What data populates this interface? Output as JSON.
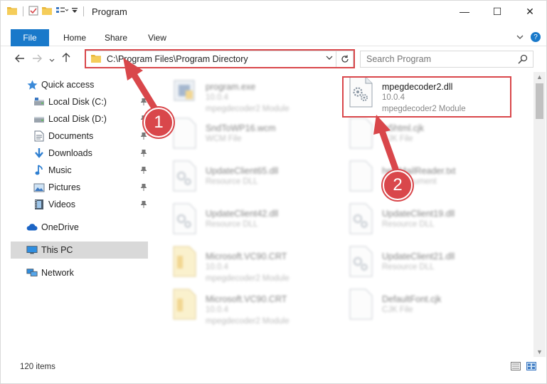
{
  "window": {
    "title": "Program",
    "controls": [
      "—",
      "☐",
      "✕"
    ]
  },
  "ribbon": {
    "tabs": [
      "File",
      "Home",
      "Share",
      "View"
    ],
    "help": "?"
  },
  "address": {
    "path": "C:\\Program Files\\Program Directory"
  },
  "search": {
    "placeholder": "Search Program"
  },
  "navpane": {
    "items": [
      {
        "label": "Quick access",
        "icon": "star-icon",
        "pinned": false
      },
      {
        "label": "Local Disk (C:)",
        "icon": "drive-icon",
        "pinned": true
      },
      {
        "label": "Local Disk (D:)",
        "icon": "drive-icon",
        "pinned": true
      },
      {
        "label": "Documents",
        "icon": "documents-icon",
        "pinned": true
      },
      {
        "label": "Downloads",
        "icon": "download-icon",
        "pinned": true
      },
      {
        "label": "Music",
        "icon": "music-icon",
        "pinned": true
      },
      {
        "label": "Pictures",
        "icon": "pictures-icon",
        "pinned": true
      },
      {
        "label": "Videos",
        "icon": "videos-icon",
        "pinned": true
      },
      {
        "label": "OneDrive",
        "icon": "cloud-icon",
        "pinned": false
      },
      {
        "label": "This PC",
        "icon": "computer-icon",
        "pinned": false,
        "selected": true
      },
      {
        "label": "Network",
        "icon": "network-icon",
        "pinned": false
      }
    ]
  },
  "files": [
    {
      "name": "program.exe",
      "line2": "10.0.4",
      "line3": "mpegdecoder2 Module",
      "kind": "exe",
      "blurred": true
    },
    {
      "name": "mpegdecoder2.dll",
      "line2": "10.0.4",
      "line3": "mpegdecoder2 Module",
      "kind": "dll",
      "blurred": false
    },
    {
      "name": "SndToWP16.wcm",
      "line2": "WCM File",
      "line3": "",
      "kind": "doc",
      "blurred": true
    },
    {
      "name": "ja5html.cjk",
      "line2": "CJK File",
      "line3": "",
      "kind": "doc",
      "blurred": true
    },
    {
      "name": "UpdateClient65.dll",
      "line2": "Resource DLL",
      "line3": "",
      "kind": "dll",
      "blurred": true
    },
    {
      "name": "helpMailReader.txt",
      "line2": "Text Document",
      "line3": "",
      "kind": "doc",
      "blurred": true
    },
    {
      "name": "UpdateClient42.dll",
      "line2": "Resource DLL",
      "line3": "",
      "kind": "dll",
      "blurred": true
    },
    {
      "name": "UpdateClient19.dll",
      "line2": "Resource DLL",
      "line3": "",
      "kind": "dll",
      "blurred": true
    },
    {
      "name": "Microsoft.VC90.CRT",
      "line2": "10.0.4",
      "line3": "mpegdecoder2 Module",
      "kind": "folder",
      "blurred": true
    },
    {
      "name": "UpdateClient21.dll",
      "line2": "Resource DLL",
      "line3": "",
      "kind": "dll",
      "blurred": true
    },
    {
      "name": "Microsoft.VC90.CRT",
      "line2": "10.0.4",
      "line3": "mpegdecoder2 Module",
      "kind": "folder",
      "blurred": true
    },
    {
      "name": "DefaultFont.cjk",
      "line2": "CJK File",
      "line3": "",
      "kind": "doc",
      "blurred": true
    }
  ],
  "status": {
    "count": "120 items"
  },
  "callouts": [
    "1",
    "2"
  ],
  "colors": {
    "accent": "#1979ca",
    "highlight": "#d9474b"
  }
}
